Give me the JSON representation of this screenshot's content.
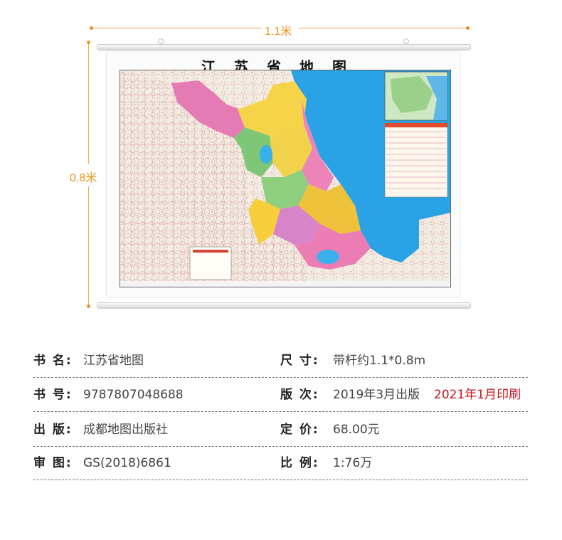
{
  "dimensions": {
    "width_label": "1.1米",
    "height_label": "0.8米",
    "accent_color": "#f0941c"
  },
  "map": {
    "title": "江苏省地图"
  },
  "specs": [
    {
      "left_key": "书  名:",
      "left_val": "江苏省地图",
      "right_key": "尺  寸:",
      "right_val": "带杆约1.1*0.8m",
      "right_extra": ""
    },
    {
      "left_key": "书  号:",
      "left_val": "9787807048688",
      "right_key": "版  次:",
      "right_val": "2019年3月出版",
      "right_extra": "2021年1月印刷"
    },
    {
      "left_key": "出  版:",
      "left_val": "成都地图出版社",
      "right_key": "定  价:",
      "right_val": "68.00元",
      "right_extra": ""
    },
    {
      "left_key": "审  图:",
      "left_val": "GS(2018)6861",
      "right_key": "比  例:",
      "right_val": "1:76万",
      "right_extra": ""
    }
  ],
  "colors": {
    "highlight_red": "#c8161d",
    "sea": "#2aa3e6"
  }
}
